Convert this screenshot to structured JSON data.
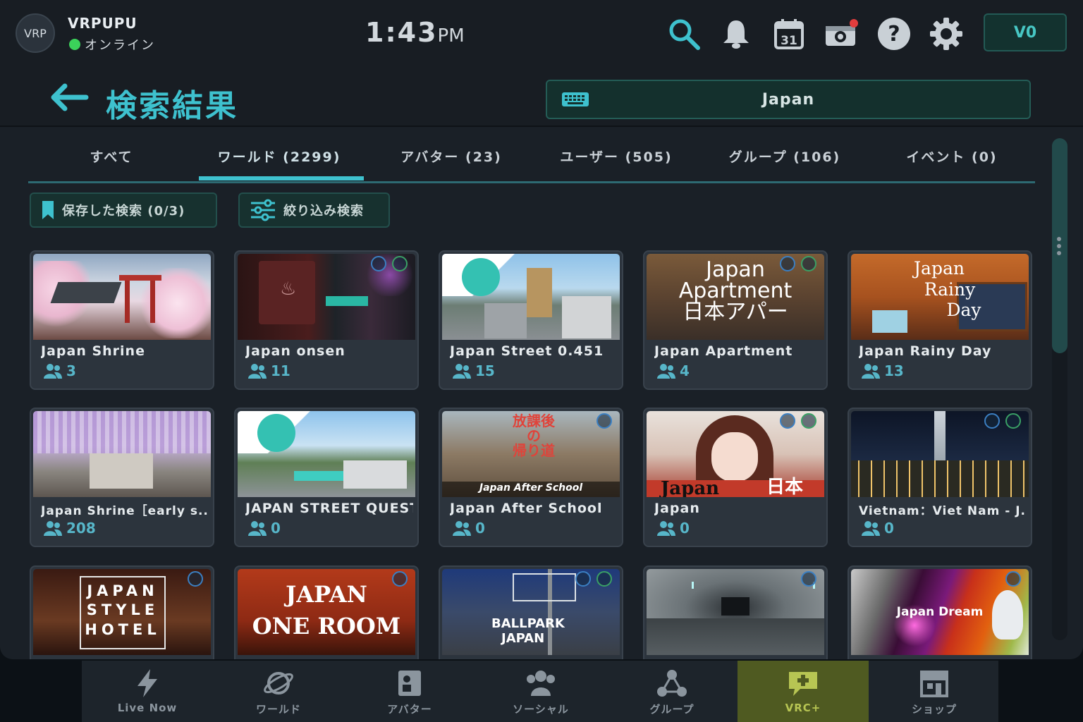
{
  "user": {
    "avatar_text": "VRP",
    "name": "VRPUPU",
    "status": "オンライン"
  },
  "clock": {
    "time": "1:43",
    "ampm": "PM"
  },
  "credits": {
    "value": "V0"
  },
  "header": {
    "title": "検索結果",
    "query": "Japan"
  },
  "tabs": [
    {
      "label": "すべて"
    },
    {
      "label": "ワールド (2299)"
    },
    {
      "label": "アバター (23)"
    },
    {
      "label": "ユーザー (505)"
    },
    {
      "label": "グループ (106)"
    },
    {
      "label": "イベント (0)"
    }
  ],
  "active_tab": "ワールド (2299)",
  "actions": {
    "saved_search": "保存した検索 (0/3)",
    "filter": "絞り込み検索"
  },
  "worlds": [
    {
      "title": "Japan Shrine",
      "count": "3"
    },
    {
      "title": "Japan onsen",
      "count": "11"
    },
    {
      "title": "Japan Street 0.451",
      "count": "15"
    },
    {
      "title": "Japan Apartment",
      "count": "4"
    },
    {
      "title": "Japan Rainy Day",
      "count": "13"
    },
    {
      "title": "Japan Shrine［early s...",
      "count": "208"
    },
    {
      "title": "JAPAN STREET QUEST",
      "count": "0"
    },
    {
      "title": "Japan After School",
      "count": "0"
    },
    {
      "title": "Japan",
      "count": "0"
    },
    {
      "title": "Vietnam：Viet Nam - J...",
      "count": "0"
    }
  ],
  "thumb_text": {
    "apartment": [
      "Japan",
      "Apartment",
      "日本アパー"
    ],
    "rainy": [
      "Japan",
      "Rainy",
      "Day"
    ],
    "after_school_sign": [
      "放課後",
      "の",
      "帰り道"
    ],
    "after_school_banner": "Japan After School",
    "japan_banner": [
      "Japan",
      "日本"
    ],
    "hotel": [
      "JAPAN",
      "STYLE",
      "HOTEL"
    ],
    "one_room": [
      "JAPAN",
      "ONE ROOM"
    ],
    "ballpark": [
      "BALLPARK",
      "JAPAN"
    ],
    "dream": "Japan Dream"
  },
  "nav": [
    {
      "label": "Live Now"
    },
    {
      "label": "ワールド"
    },
    {
      "label": "アバター"
    },
    {
      "label": "ソーシャル"
    },
    {
      "label": "グループ"
    },
    {
      "label": "VRC+"
    },
    {
      "label": "ショップ"
    }
  ],
  "colors": {
    "accent": "#3ec1ce",
    "online": "#3bd15a",
    "vrc_plus": "#b7c553"
  }
}
